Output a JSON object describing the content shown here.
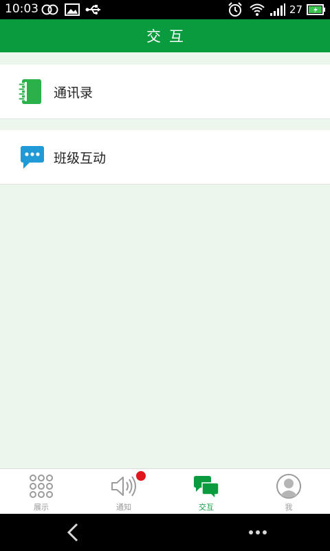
{
  "status_bar": {
    "time": "10:03",
    "battery_level": "27",
    "icons": [
      "link-icon",
      "image-icon",
      "usb-icon",
      "alarm-icon",
      "wifi-icon",
      "signal-icon",
      "battery-icon"
    ]
  },
  "header": {
    "title": "交互"
  },
  "list": {
    "items": [
      {
        "label": "通讯录",
        "icon": "address-book-icon",
        "icon_color": "#2bb14a"
      },
      {
        "label": "班级互动",
        "icon": "chat-bubble-icon",
        "icon_color": "#1f9ad6"
      }
    ]
  },
  "bottom_nav": {
    "tabs": [
      {
        "label": "展示",
        "icon": "grid-dots-icon",
        "active": false
      },
      {
        "label": "通知",
        "icon": "speaker-icon",
        "active": false,
        "badge": true
      },
      {
        "label": "交互",
        "icon": "chat-bubbles-icon",
        "active": true
      },
      {
        "label": "我",
        "icon": "user-avatar-icon",
        "active": false
      }
    ]
  },
  "colors": {
    "primary": "#099b3e",
    "background": "#edf6ec",
    "badge": "#e0161c",
    "inactive_text": "#9a9a9a"
  }
}
